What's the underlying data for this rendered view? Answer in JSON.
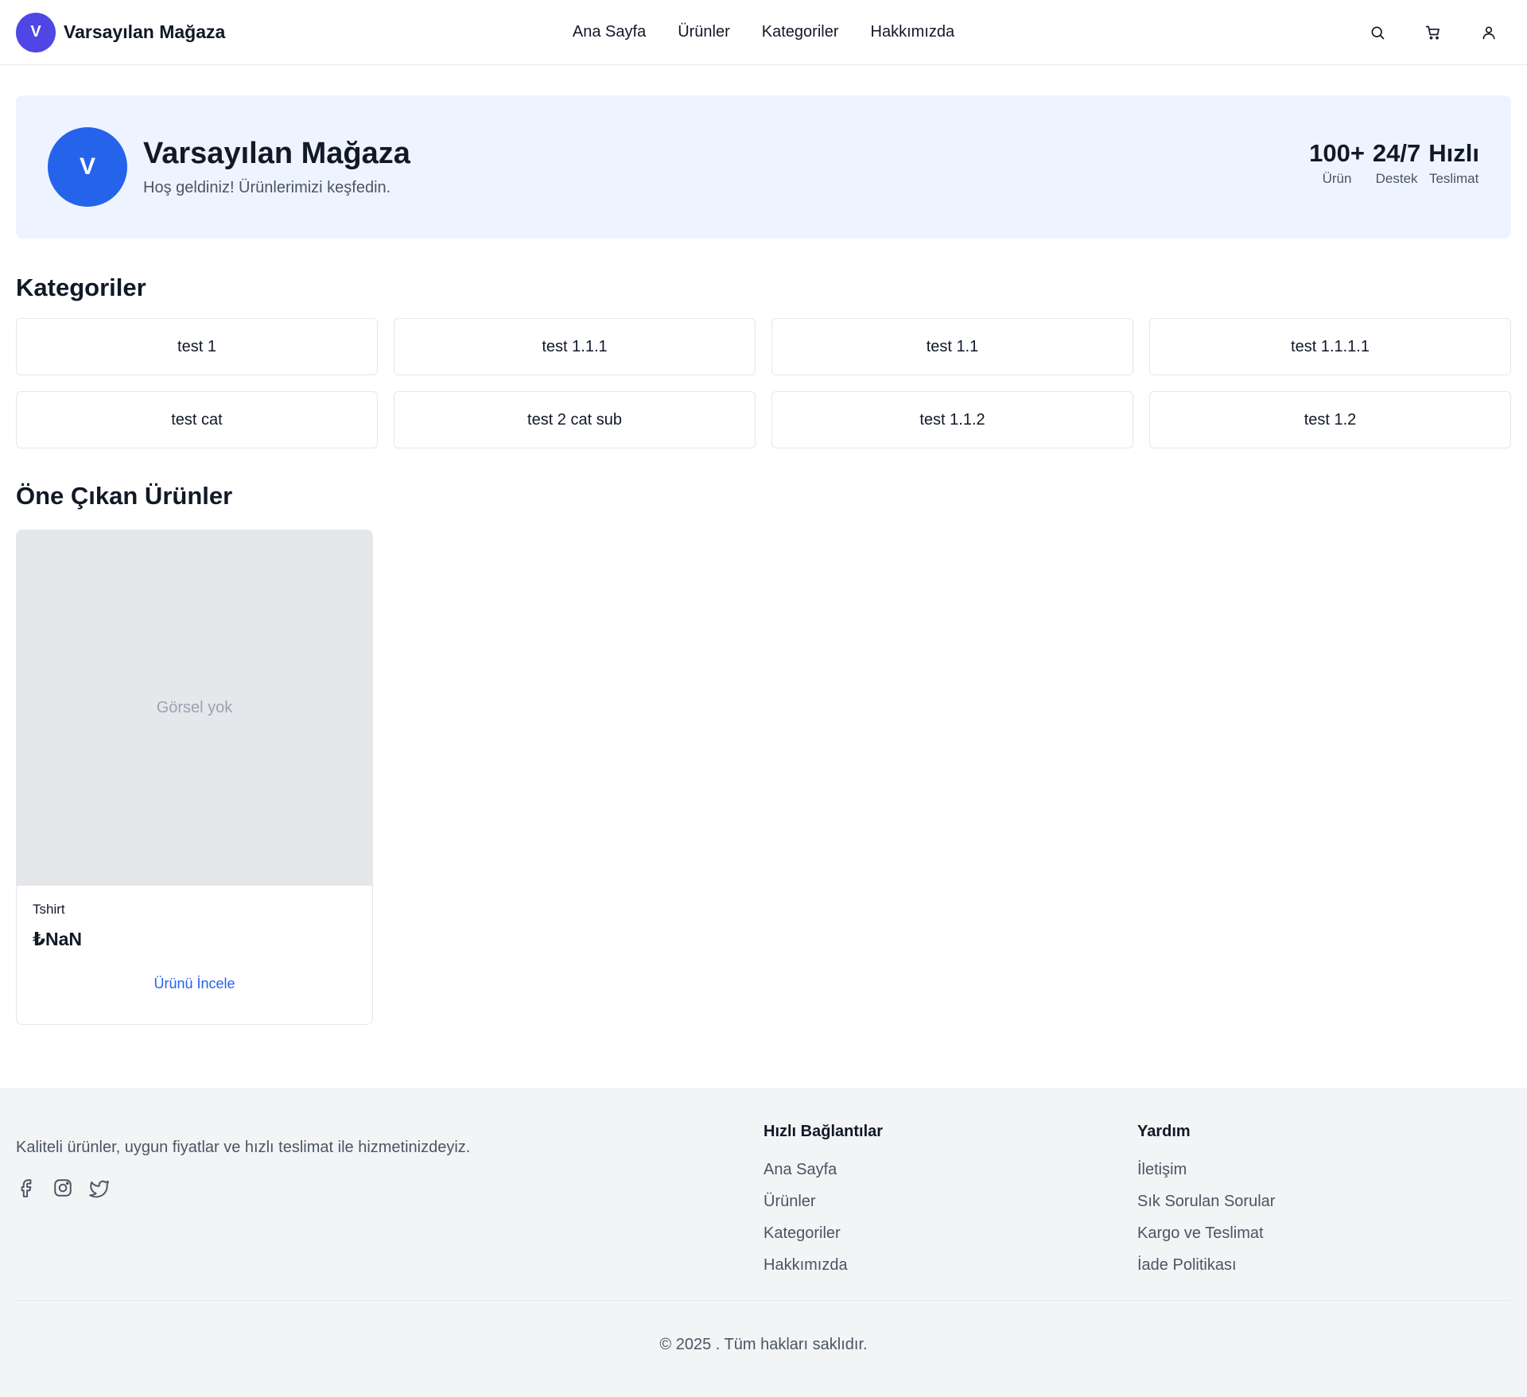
{
  "header": {
    "brand_initial": "V",
    "brand_name": "Varsayılan Mağaza",
    "nav": [
      "Ana Sayfa",
      "Ürünler",
      "Kategoriler",
      "Hakkımızda"
    ],
    "icons": [
      "search-icon",
      "cart-icon",
      "user-icon"
    ]
  },
  "hero": {
    "initial": "V",
    "title": "Varsayılan Mağaza",
    "subtitle": "Hoş geldiniz! Ürünlerimizi keşfedin.",
    "stats": [
      {
        "value": "100+",
        "label": "Ürün"
      },
      {
        "value": "24/7",
        "label": "Destek"
      },
      {
        "value": "Hızlı",
        "label": "Teslimat"
      }
    ]
  },
  "categories": {
    "title": "Kategoriler",
    "items": [
      "test 1",
      "test 1.1.1",
      "test 1.1",
      "test 1.1.1.1",
      "test cat",
      "test 2 cat sub",
      "test 1.1.2",
      "test 1.2"
    ]
  },
  "featured": {
    "title": "Öne Çıkan Ürünler",
    "products": [
      {
        "image_placeholder": "Görsel yok",
        "name": "Tshirt",
        "price": "₺NaN",
        "link": "Ürünü İncele"
      }
    ]
  },
  "footer": {
    "description": "Kaliteli ürünler, uygun fiyatlar ve hızlı teslimat ile hizmetinizdeyiz.",
    "socials": [
      "facebook-icon",
      "instagram-icon",
      "twitter-icon"
    ],
    "quick_links": {
      "title": "Hızlı Bağlantılar",
      "items": [
        "Ana Sayfa",
        "Ürünler",
        "Kategoriler",
        "Hakkımızda"
      ]
    },
    "help": {
      "title": "Yardım",
      "items": [
        "İletişim",
        "Sık Sorulan Sorular",
        "Kargo ve Teslimat",
        "İade Politikası"
      ]
    },
    "copyright": "© 2025 . Tüm hakları saklıdır."
  },
  "colors": {
    "brand_avatar": "#4f46e5",
    "hero_avatar": "#2563eb",
    "hero_bg": "#eef4ff",
    "link": "#2563eb",
    "footer_bg": "#f3f4f6"
  }
}
